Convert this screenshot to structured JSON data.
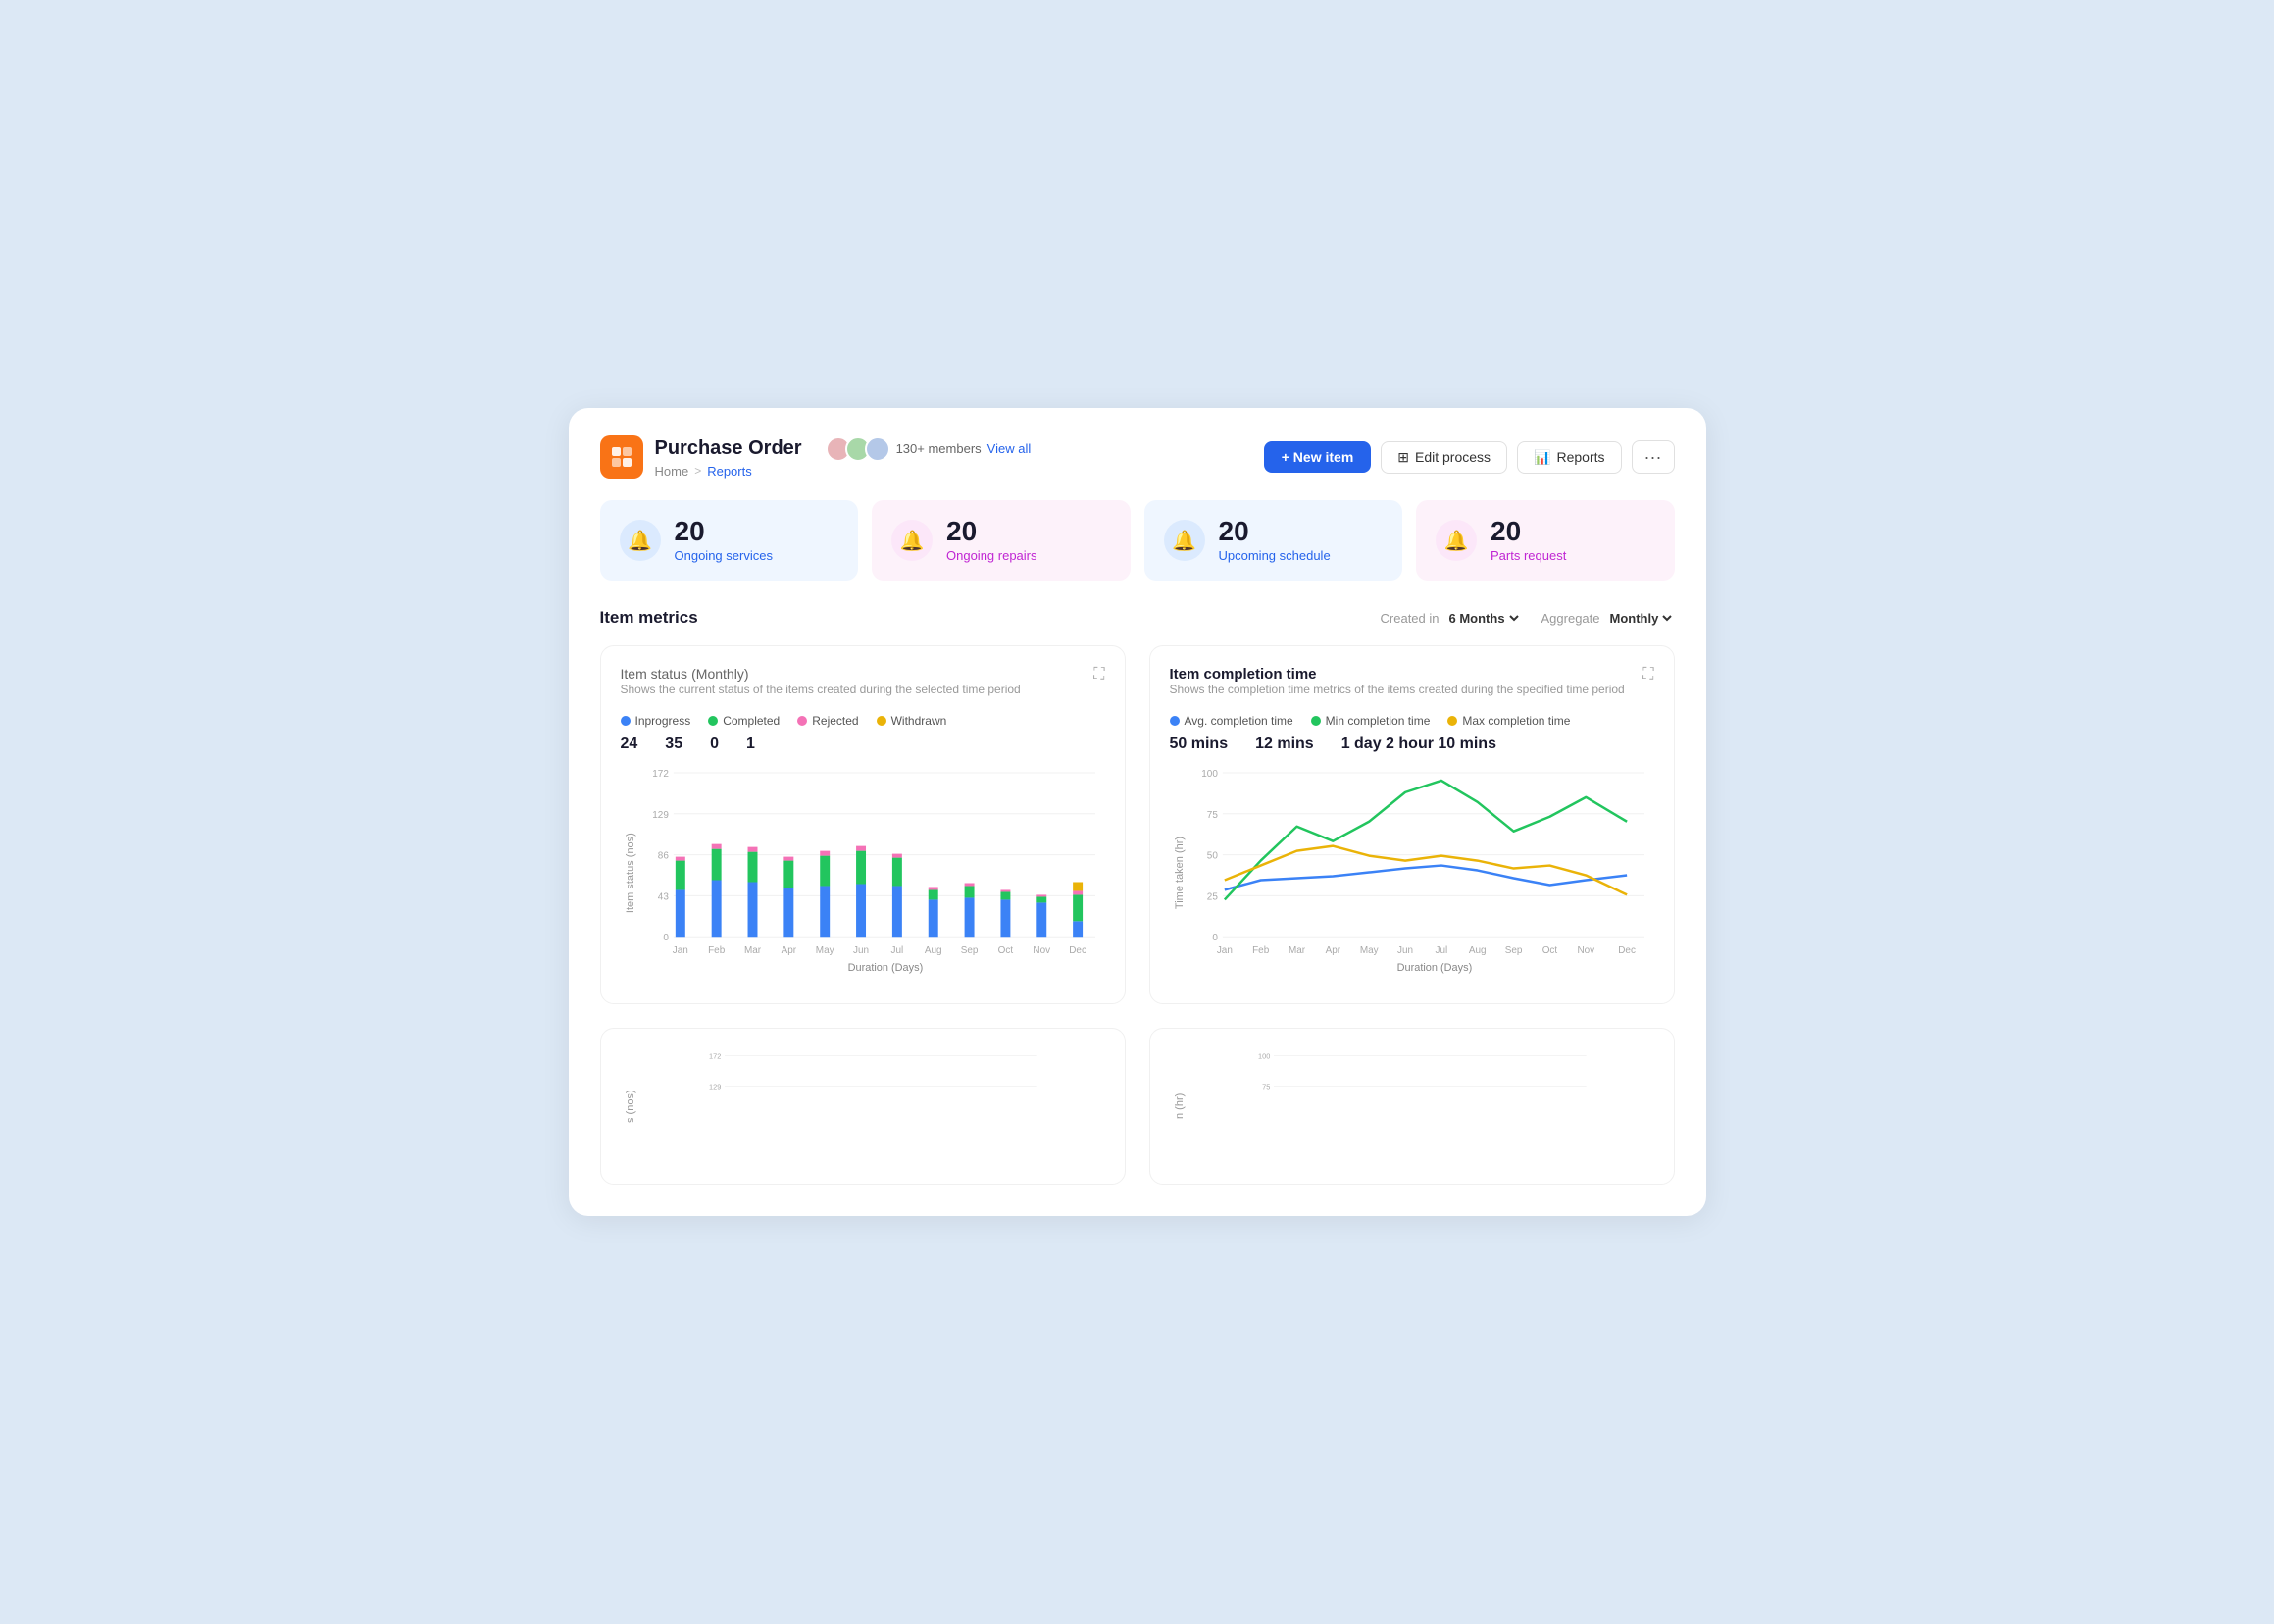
{
  "app": {
    "icon_color": "#f97316",
    "title": "Purchase Order",
    "members_count": "130+ members",
    "view_all": "View all",
    "breadcrumb": {
      "home": "Home",
      "separator": ">",
      "current": "Reports"
    }
  },
  "header_actions": {
    "new_item": "+ New item",
    "edit_process": "Edit process",
    "reports": "Reports"
  },
  "stats": [
    {
      "number": "20",
      "label": "Ongoing services",
      "theme": "blue"
    },
    {
      "number": "20",
      "label": "Ongoing repairs",
      "theme": "pink"
    },
    {
      "number": "20",
      "label": "Upcoming schedule",
      "theme": "blue"
    },
    {
      "number": "20",
      "label": "Parts request",
      "theme": "pink"
    }
  ],
  "metrics": {
    "title": "Item metrics",
    "created_in_label": "Created in",
    "created_in_value": "6 Months",
    "aggregate_label": "Aggregate",
    "aggregate_value": "Monthly"
  },
  "bar_chart": {
    "title": "Item status",
    "period": "(Monthly)",
    "subtitle": "Shows the current status of the items created during the selected time period",
    "legend": [
      {
        "label": "Inprogress",
        "color": "#3b82f6"
      },
      {
        "label": "Completed",
        "color": "#22c55e"
      },
      {
        "label": "Rejected",
        "color": "#f472b6"
      },
      {
        "label": "Withdrawn",
        "color": "#eab308"
      }
    ],
    "stats": [
      {
        "value": "24"
      },
      {
        "value": "35"
      },
      {
        "value": "0"
      },
      {
        "value": "1"
      }
    ],
    "y_axis_label": "Item status (nos)",
    "x_axis_label": "Duration (Days)",
    "y_ticks": [
      "172",
      "129",
      "86",
      "43",
      "0"
    ],
    "x_labels": [
      "Jan",
      "Feb",
      "Mar",
      "Apr",
      "May",
      "Jun",
      "Jul",
      "Aug",
      "Sep",
      "Oct",
      "Nov",
      "Dec"
    ],
    "bars": [
      {
        "inprogress": 48,
        "completed": 28,
        "rejected": 4,
        "withdrawn": 0
      },
      {
        "inprogress": 44,
        "completed": 40,
        "rejected": 5,
        "withdrawn": 0
      },
      {
        "inprogress": 46,
        "completed": 38,
        "rejected": 6,
        "withdrawn": 0
      },
      {
        "inprogress": 42,
        "completed": 32,
        "rejected": 4,
        "withdrawn": 0
      },
      {
        "inprogress": 40,
        "completed": 36,
        "rejected": 5,
        "withdrawn": 0
      },
      {
        "inprogress": 38,
        "completed": 40,
        "rejected": 5,
        "withdrawn": 0
      },
      {
        "inprogress": 36,
        "completed": 34,
        "rejected": 4,
        "withdrawn": 0
      },
      {
        "inprogress": 30,
        "completed": 12,
        "rejected": 3,
        "withdrawn": 0
      },
      {
        "inprogress": 32,
        "completed": 14,
        "rejected": 3,
        "withdrawn": 0
      },
      {
        "inprogress": 30,
        "completed": 10,
        "rejected": 2,
        "withdrawn": 0
      },
      {
        "inprogress": 28,
        "completed": 8,
        "rejected": 2,
        "withdrawn": 0
      },
      {
        "inprogress": 8,
        "completed": 30,
        "rejected": 4,
        "withdrawn": 6
      }
    ]
  },
  "line_chart": {
    "title": "Item completion time",
    "subtitle": "Shows the completion time metrics of the items created during the specified time period",
    "legend": [
      {
        "label": "Avg. completion time",
        "color": "#3b82f6"
      },
      {
        "label": "Min completion time",
        "color": "#22c55e"
      },
      {
        "label": "Max completion time",
        "color": "#eab308"
      }
    ],
    "stats": [
      {
        "value": "50 mins"
      },
      {
        "value": "12 mins"
      },
      {
        "value": "1 day 2 hour 10 mins"
      }
    ],
    "y_axis_label": "Time taken (hr)",
    "x_axis_label": "Duration (Days)",
    "y_ticks": [
      "100",
      "75",
      "50",
      "25",
      "0"
    ],
    "x_labels": [
      "Jan",
      "Feb",
      "Mar",
      "Apr",
      "May",
      "Jun",
      "Jul",
      "Aug",
      "Sep",
      "Oct",
      "Nov",
      "Dec"
    ]
  }
}
